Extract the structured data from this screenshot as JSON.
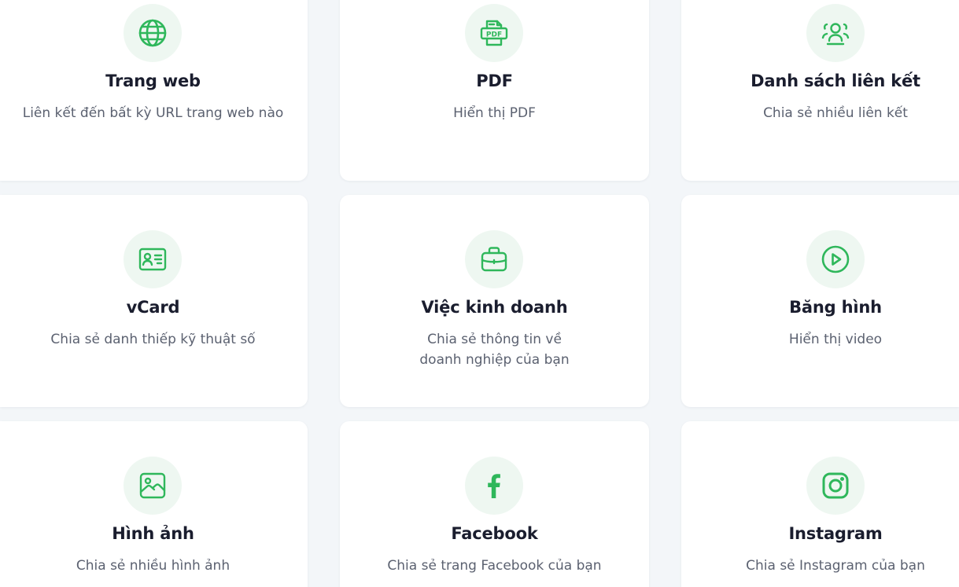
{
  "accent_color": "#2fb75b",
  "icon_bg_color": "#eef7f1",
  "cards": [
    {
      "icon": "globe-icon",
      "title": "Trang web",
      "desc": "Liên kết đến bất kỳ URL trang web nào"
    },
    {
      "icon": "pdf-icon",
      "title": "PDF",
      "desc": "Hiển thị PDF"
    },
    {
      "icon": "users-group-icon",
      "title": "Danh sách liên kết",
      "desc": "Chia sẻ nhiều liên kết"
    },
    {
      "icon": "id-card-icon",
      "title": "vCard",
      "desc": "Chia sẻ danh thiếp kỹ thuật số"
    },
    {
      "icon": "briefcase-icon",
      "title": "Việc kinh doanh",
      "desc": "Chia sẻ thông tin về doanh nghiệp của bạn"
    },
    {
      "icon": "play-circle-icon",
      "title": "Băng hình",
      "desc": "Hiển thị video"
    },
    {
      "icon": "image-icon",
      "title": "Hình ảnh",
      "desc": "Chia sẻ nhiều hình ảnh"
    },
    {
      "icon": "facebook-icon",
      "title": "Facebook",
      "desc": "Chia sẻ trang Facebook của bạn"
    },
    {
      "icon": "instagram-icon",
      "title": "Instagram",
      "desc": "Chia sẻ Instagram của bạn"
    }
  ]
}
